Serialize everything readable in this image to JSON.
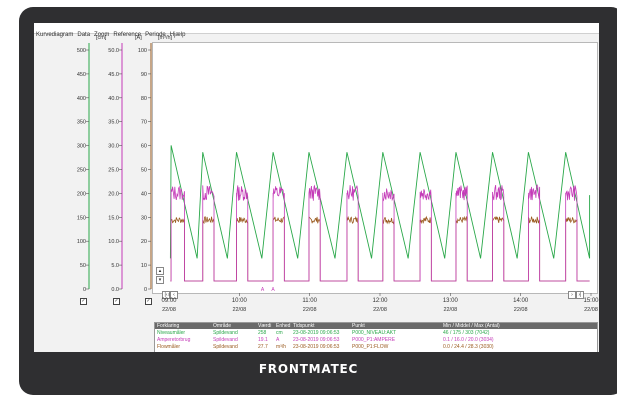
{
  "menu": [
    "Kurvediagram",
    "Data",
    "Zoom",
    "Reference",
    "Periode",
    "Hjælp"
  ],
  "axes": {
    "units": [
      "[cm]",
      "[A]",
      "[m³/h]"
    ],
    "ticks_cm": [
      "500",
      "450",
      "400",
      "350",
      "300",
      "250",
      "200",
      "150",
      "100",
      "50",
      "0"
    ],
    "ticks_a": [
      "50.0",
      "45.0",
      "40.0",
      "35.0",
      "30.0",
      "25.0",
      "20.0",
      "15.0",
      "10.0",
      "5.0",
      "0.0"
    ],
    "ticks_flow": [
      "100",
      "90",
      "80",
      "70",
      "60",
      "50",
      "40",
      "30",
      "20",
      "10",
      "0"
    ],
    "colors": {
      "cm": "#2aa84a",
      "a": "#c43bb8",
      "flow": "#9a5a1f"
    }
  },
  "time_axis": {
    "labels": [
      {
        "time": "09:00",
        "date": "22/08"
      },
      {
        "time": "10:00",
        "date": "22/08"
      },
      {
        "time": "11:00",
        "date": "22/08"
      },
      {
        "time": "12:00",
        "date": "22/08"
      },
      {
        "time": "13:00",
        "date": "22/08"
      },
      {
        "time": "14:00",
        "date": "22/08"
      },
      {
        "time": "15:00",
        "date": "22/08"
      }
    ]
  },
  "markers": [
    "A",
    "A"
  ],
  "legend": {
    "headers": [
      "Forklaring",
      "Område",
      "Værdi",
      "Enhed",
      "Tidspunkt",
      "Punkt",
      "Min / Middel / Max (Antal)"
    ],
    "rows": [
      {
        "forklaring": "Niveaumåler",
        "omraade": "Spildevand",
        "vaerdi": "258",
        "enhed": "cm",
        "tidspunkt": "23-08-2019 09:06:53",
        "punkt": "P000_NIVEAU:AKT",
        "stats": "46 / 175 / 303 (7042)",
        "color": "#2aa84a"
      },
      {
        "forklaring": "Amperetorbrug",
        "omraade": "Spildevand",
        "vaerdi": "19.1",
        "enhed": "A",
        "tidspunkt": "23-08-2019 09:06:53",
        "punkt": "P000_P1:AMPERE",
        "stats": "0.1 / 16.0 / 20.0 (3034)",
        "color": "#c43bb8"
      },
      {
        "forklaring": "Flowmåler",
        "omraade": "Spildevand",
        "vaerdi": "27.7",
        "enhed": "m³/h",
        "tidspunkt": "23-08-2019 09:06:53",
        "punkt": "P000_P1:FLOW",
        "stats": "0.0 / 24.4 / 28.3 (3030)",
        "color": "#9a5a1f"
      }
    ]
  },
  "chart_data": {
    "type": "line",
    "x_label_times": [
      "09:00",
      "10:00",
      "11:00",
      "12:00",
      "13:00",
      "14:00",
      "15:00"
    ],
    "series": [
      {
        "name": "Niveaumåler",
        "unit": "cm",
        "color": "#2aa84a",
        "cycles": [
          {
            "peak_h": 9.03,
            "peak_val": 300,
            "low_h": 9.4,
            "low_val": 50
          },
          {
            "peak_h": 9.48,
            "peak_val": 285,
            "low_h": 9.83,
            "low_val": 50
          },
          {
            "peak_h": 9.96,
            "peak_val": 285,
            "low_h": 10.32,
            "low_val": 50
          },
          {
            "peak_h": 10.48,
            "peak_val": 285,
            "low_h": 10.83,
            "low_val": 50
          },
          {
            "peak_h": 10.99,
            "peak_val": 285,
            "low_h": 11.36,
            "low_val": 50
          },
          {
            "peak_h": 11.53,
            "peak_val": 285,
            "low_h": 11.88,
            "low_val": 50
          },
          {
            "peak_h": 12.04,
            "peak_val": 285,
            "low_h": 12.4,
            "low_val": 50
          },
          {
            "peak_h": 12.57,
            "peak_val": 285,
            "low_h": 12.92,
            "low_val": 50
          },
          {
            "peak_h": 13.08,
            "peak_val": 285,
            "low_h": 13.43,
            "low_val": 50
          },
          {
            "peak_h": 13.6,
            "peak_val": 285,
            "low_h": 13.95,
            "low_val": 50
          },
          {
            "peak_h": 14.11,
            "peak_val": 285,
            "low_h": 14.47,
            "low_val": 50
          },
          {
            "peak_h": 14.64,
            "peak_val": 285,
            "low_h": 14.98,
            "low_val": 50
          }
        ]
      },
      {
        "name": "Amperetorbrug",
        "unit": "A",
        "color": "#c43bb8",
        "on_intervals": [
          [
            9.03,
            9.22
          ],
          [
            9.48,
            9.64
          ],
          [
            9.96,
            10.12
          ],
          [
            10.48,
            10.64
          ],
          [
            10.99,
            11.15
          ],
          [
            11.53,
            11.69
          ],
          [
            12.04,
            12.2
          ],
          [
            12.57,
            12.73
          ],
          [
            13.08,
            13.24
          ],
          [
            13.6,
            13.76
          ],
          [
            14.11,
            14.27
          ],
          [
            14.64,
            14.8
          ]
        ],
        "on_level": 19.5,
        "off_level": 0
      },
      {
        "name": "Flowmåler",
        "unit": "m³/h",
        "color": "#9a5a1f",
        "on_intervals": [
          [
            9.03,
            9.22
          ],
          [
            9.48,
            9.64
          ],
          [
            9.96,
            10.12
          ],
          [
            10.48,
            10.64
          ],
          [
            10.99,
            11.15
          ],
          [
            11.53,
            11.69
          ],
          [
            12.04,
            12.2
          ],
          [
            12.57,
            12.73
          ],
          [
            13.08,
            13.24
          ],
          [
            13.6,
            13.76
          ],
          [
            14.11,
            14.27
          ],
          [
            14.64,
            14.8
          ]
        ],
        "on_level": 27,
        "off_level": 0
      }
    ],
    "x_range_hours": [
      9,
      15
    ],
    "y_range_cm": [
      0,
      500
    ],
    "y_range_a": [
      0,
      50
    ],
    "y_range_flow": [
      0,
      100
    ]
  }
}
